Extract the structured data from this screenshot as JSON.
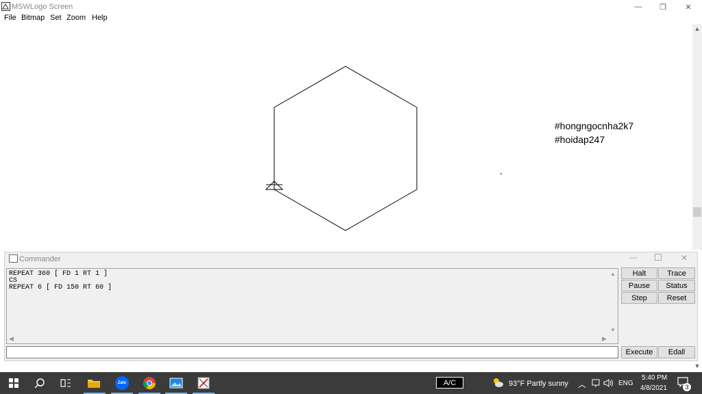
{
  "window": {
    "title": "MSWLogo Screen",
    "minimize_glyph": "—",
    "maximize_glyph": "❐",
    "close_glyph": "✕"
  },
  "menu": [
    "File",
    "Bitmap",
    "Set",
    "Zoom",
    "Help"
  ],
  "canvas": {
    "tags": [
      "#hongngocnha2k7",
      "#hoidap247"
    ]
  },
  "commander": {
    "title": "Commander",
    "history": [
      "REPEAT 360 [ FD 1 RT 1 ]",
      "CS",
      "REPEAT 6 [ FD 150 RT 60 ]"
    ],
    "input_value": "",
    "buttons": {
      "halt": "Halt",
      "trace": "Trace",
      "pause": "Pause",
      "status": "Status",
      "step": "Step",
      "reset": "Reset",
      "execute": "Execute",
      "edall": "Edall"
    }
  },
  "taskbar": {
    "ac_label": "A/C",
    "weather": "93°F  Partly sunny",
    "language": "ENG",
    "time": "5:40 PM",
    "date": "4/8/2021",
    "notification_count": "3",
    "zalo_label": "Zalo"
  },
  "colors": {
    "taskbar": "#3b3b3b",
    "commander_bg": "#f0f0f0",
    "accent": "#0078d7"
  }
}
